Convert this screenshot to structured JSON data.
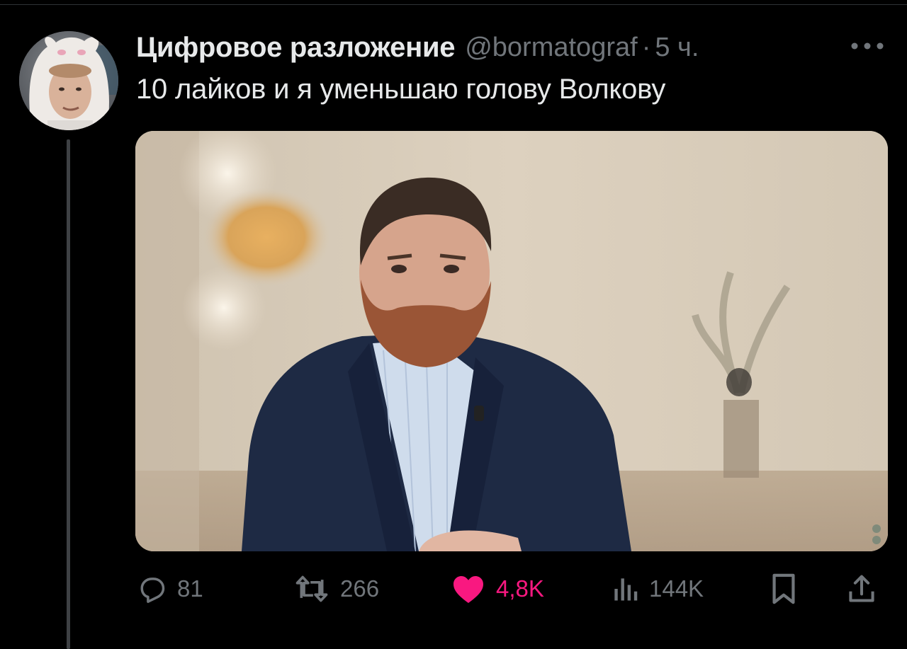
{
  "tweet": {
    "author": {
      "display_name": "Цифровое разложение",
      "handle": "@bormatograf",
      "avatar_icon": "avatar-bunny-hood"
    },
    "separator": "·",
    "time": "5 ч.",
    "text": "10 лайков и я уменьшаю голову Волкову",
    "media": {
      "type": "photo",
      "icon": "photo-man-in-blazer"
    },
    "actions": {
      "replies": {
        "icon": "reply-icon",
        "count": "81"
      },
      "retweets": {
        "icon": "retweet-icon",
        "count": "266"
      },
      "likes": {
        "icon": "heart-icon",
        "count": "4,8K",
        "liked": true,
        "color": "#f91880"
      },
      "views": {
        "icon": "views-icon",
        "count": "144K"
      },
      "bookmark": {
        "icon": "bookmark-icon"
      },
      "share": {
        "icon": "share-icon"
      }
    }
  },
  "colors": {
    "background": "#000000",
    "text_primary": "#e7e9ea",
    "text_secondary": "#71767b",
    "like": "#f91880",
    "thread_line": "#3e4144"
  }
}
